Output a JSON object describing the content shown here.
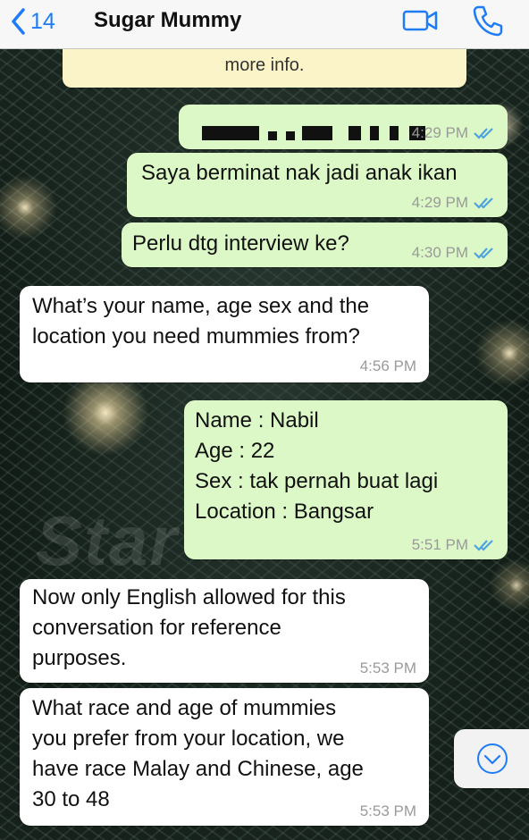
{
  "header": {
    "back_count": "14",
    "title": "Sugar Mummy",
    "video_icon": "video-camera-icon",
    "call_icon": "phone-icon",
    "accent": "#1f7cf6"
  },
  "system_note": {
    "text": "more info."
  },
  "watermark": "Star",
  "messages": [
    {
      "direction": "outgoing",
      "text": "",
      "time": "4:29 PM",
      "status": "read",
      "redacted": true
    },
    {
      "direction": "outgoing",
      "text": "Saya berminat nak jadi anak ikan",
      "time": "4:29 PM",
      "status": "read"
    },
    {
      "direction": "outgoing",
      "text": "Perlu dtg interview ke?",
      "time": "4:30 PM",
      "status": "read"
    },
    {
      "direction": "incoming",
      "lines": [
        "What’s your name, age sex and the",
        "location you need mummies from?"
      ],
      "time": "4:56 PM"
    },
    {
      "direction": "outgoing",
      "lines": [
        "Name : Nabil",
        "Age : 22",
        "Sex : tak pernah buat lagi",
        "Location : Bangsar"
      ],
      "time": "5:51 PM",
      "status": "read"
    },
    {
      "direction": "incoming",
      "lines": [
        "Now only English allowed for this",
        "conversation for reference",
        "purposes."
      ],
      "time": "5:53 PM"
    },
    {
      "direction": "incoming",
      "lines": [
        "What race and age of mummies",
        "you prefer from your location, we",
        "have race Malay and Chinese, age",
        "30 to 48"
      ],
      "time": "5:53 PM"
    }
  ],
  "colors": {
    "outgoing_bubble": "#dcf8c6",
    "incoming_bubble": "#ffffff",
    "read_ticks": "#4fa3e0",
    "system_note_bg": "#fbf4c8"
  },
  "scroll_button_icon": "chevron-down-circle-icon"
}
